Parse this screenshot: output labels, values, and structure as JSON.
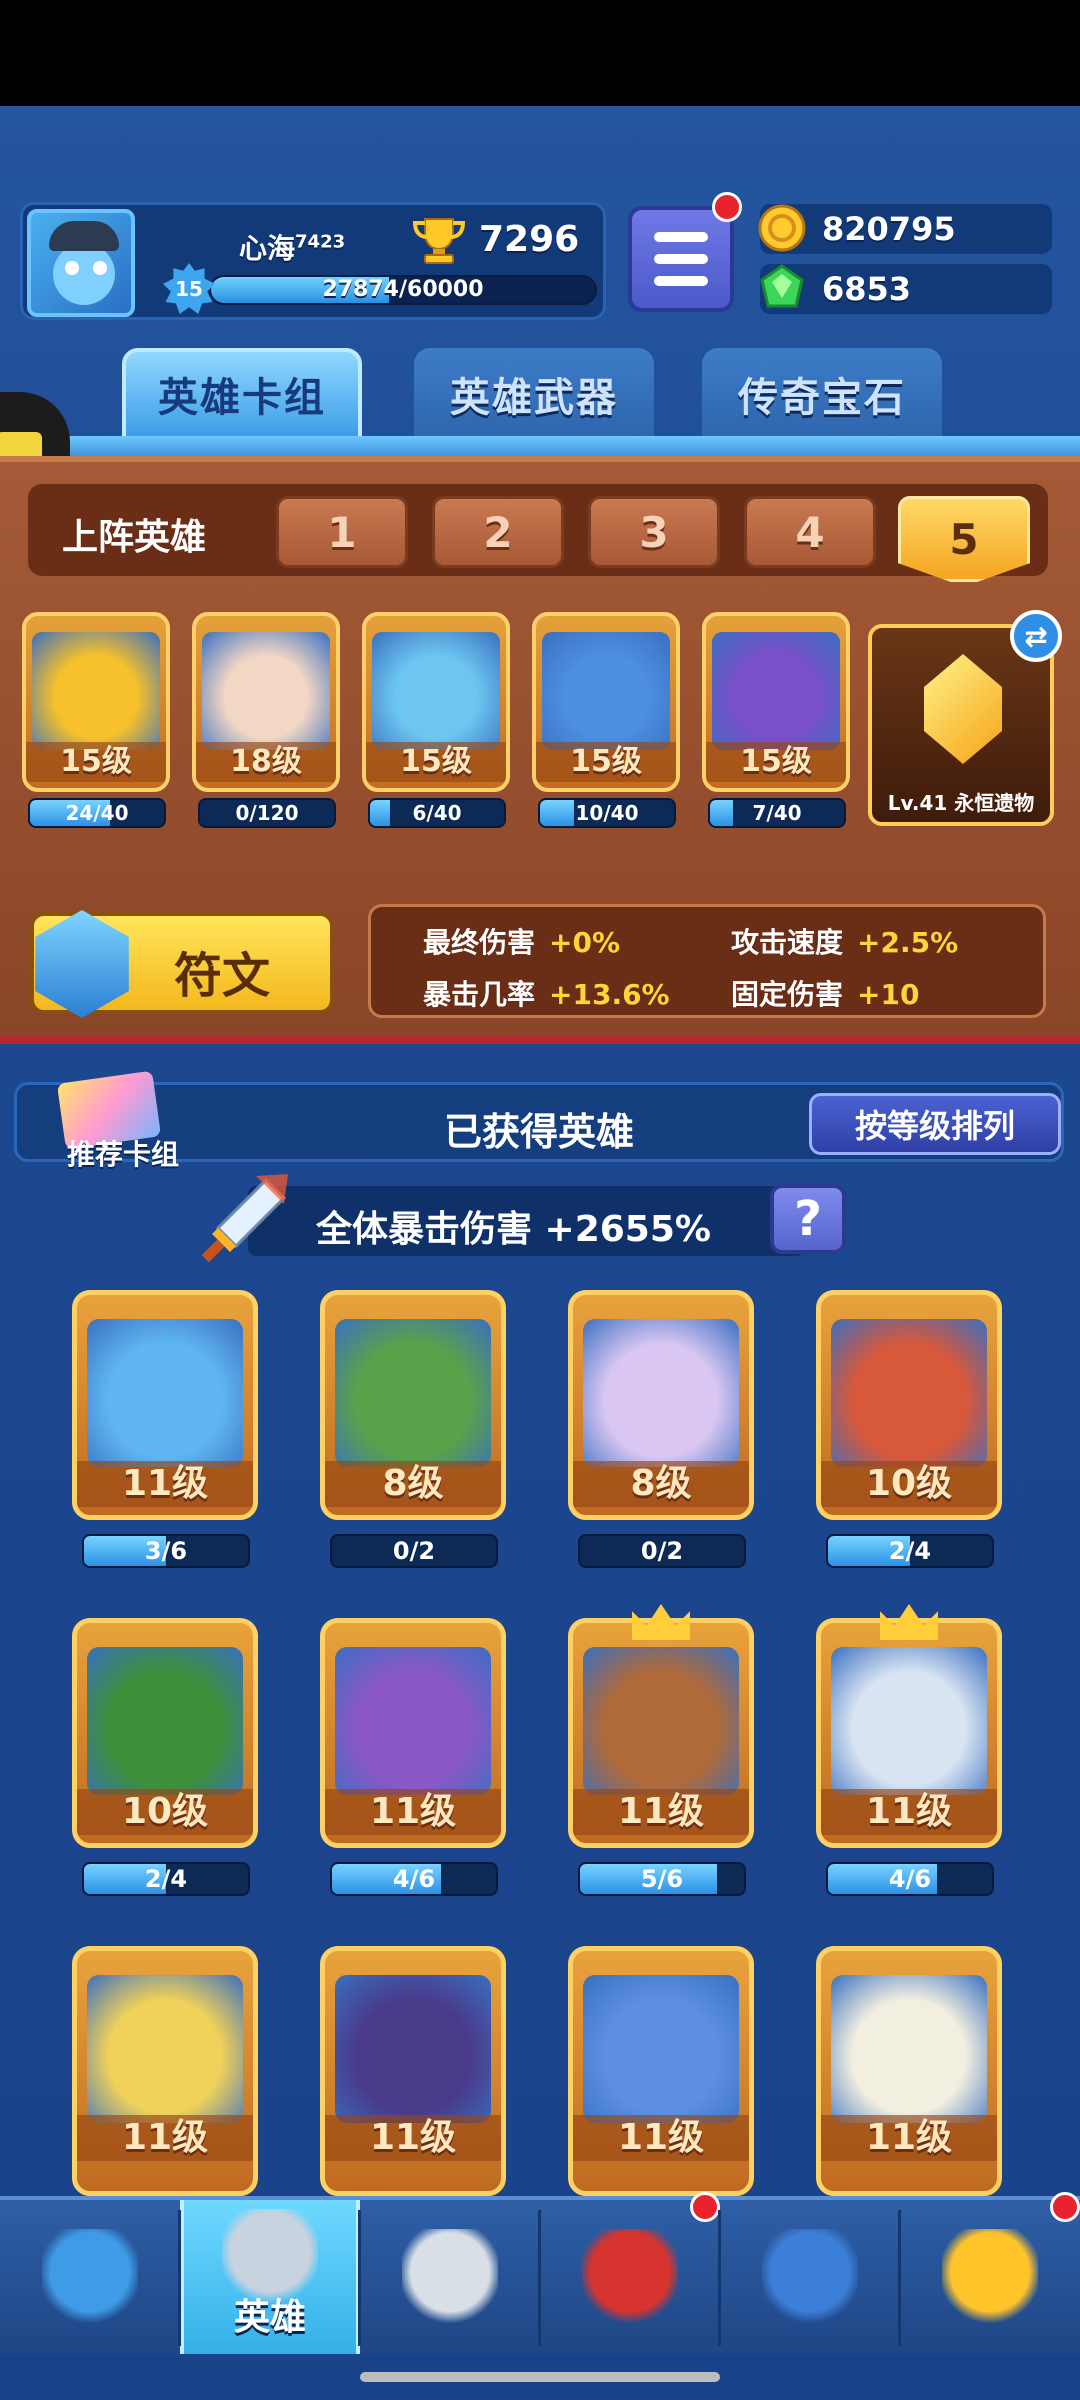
{
  "header": {
    "player_name": "心海",
    "player_tag": "7423",
    "trophies": "7296",
    "level": "15",
    "xp_text": "27874/60000",
    "xp_progress": 0.4646,
    "gold": "820795",
    "gems": "6853"
  },
  "tabs": [
    {
      "label": "英雄卡组",
      "active": true
    },
    {
      "label": "英雄武器",
      "active": false
    },
    {
      "label": "传奇宝石",
      "active": false
    }
  ],
  "deck": {
    "label": "上阵英雄",
    "slots": [
      "1",
      "2",
      "3",
      "4",
      "5"
    ],
    "active_slot": "5",
    "heroes": [
      {
        "level": "15级",
        "progress": "24/40",
        "fill": 0.6,
        "color": "#f7c12b"
      },
      {
        "level": "18级",
        "progress": "0/120",
        "fill": 0,
        "color": "#f2d7c4"
      },
      {
        "level": "15级",
        "progress": "6/40",
        "fill": 0.15,
        "color": "#6cc6f0"
      },
      {
        "level": "15级",
        "progress": "10/40",
        "fill": 0.25,
        "color": "#4d8fe0"
      },
      {
        "level": "15级",
        "progress": "7/40",
        "fill": 0.175,
        "color": "#7a4fc9"
      }
    ],
    "relic_label": "Lv.41 永恒遗物",
    "rune_label": "符文",
    "stats": [
      {
        "name": "最终伤害",
        "value": "+0%"
      },
      {
        "name": "攻击速度",
        "value": "+2.5%"
      },
      {
        "name": "暴击几率",
        "value": "+13.6%"
      },
      {
        "name": "固定伤害",
        "value": "+10"
      }
    ]
  },
  "collection": {
    "title": "已获得英雄",
    "recommend_label": "推荐卡组",
    "sort_label": "按等级排列",
    "crit_text": "全体暴击伤害 +2655%",
    "help_label": "?",
    "heroes": [
      {
        "level": "11级",
        "progress": "3/6",
        "fill": 0.5,
        "color": "#5fb6f2",
        "crown": false
      },
      {
        "level": "8级",
        "progress": "0/2",
        "fill": 0,
        "color": "#5aa24a",
        "crown": false
      },
      {
        "level": "8级",
        "progress": "0/2",
        "fill": 0,
        "color": "#d9c6f2",
        "crown": false
      },
      {
        "level": "10级",
        "progress": "2/4",
        "fill": 0.5,
        "color": "#d8583a",
        "crown": false
      },
      {
        "level": "10级",
        "progress": "2/4",
        "fill": 0.5,
        "color": "#3f8f3a",
        "crown": false
      },
      {
        "level": "11级",
        "progress": "4/6",
        "fill": 0.667,
        "color": "#8a58c8",
        "crown": false
      },
      {
        "level": "11级",
        "progress": "5/6",
        "fill": 0.833,
        "color": "#b06a3a",
        "crown": true
      },
      {
        "level": "11级",
        "progress": "4/6",
        "fill": 0.667,
        "color": "#d8e4f2",
        "crown": true
      },
      {
        "level": "11级",
        "progress": "",
        "fill": 0,
        "color": "#f0d15a",
        "crown": false
      },
      {
        "level": "11级",
        "progress": "",
        "fill": 0,
        "color": "#4a3a8a",
        "crown": false
      },
      {
        "level": "11级",
        "progress": "",
        "fill": 0,
        "color": "#5c8fe0",
        "crown": false
      },
      {
        "level": "11级",
        "progress": "",
        "fill": 0,
        "color": "#f2efe0",
        "crown": false
      }
    ]
  },
  "nav": [
    {
      "icon": "treasure-chest-icon",
      "label": "",
      "active": false,
      "badge": false
    },
    {
      "icon": "knight-helmet-icon",
      "label": "英雄",
      "active": true,
      "badge": false
    },
    {
      "icon": "crossed-swords-icon",
      "label": "",
      "active": false,
      "badge": false
    },
    {
      "icon": "crown-shield-icon",
      "label": "",
      "active": false,
      "badge": true
    },
    {
      "icon": "guild-banner-icon",
      "label": "",
      "active": false,
      "badge": false
    },
    {
      "icon": "compass-icon",
      "label": "",
      "active": false,
      "badge": true
    }
  ]
}
